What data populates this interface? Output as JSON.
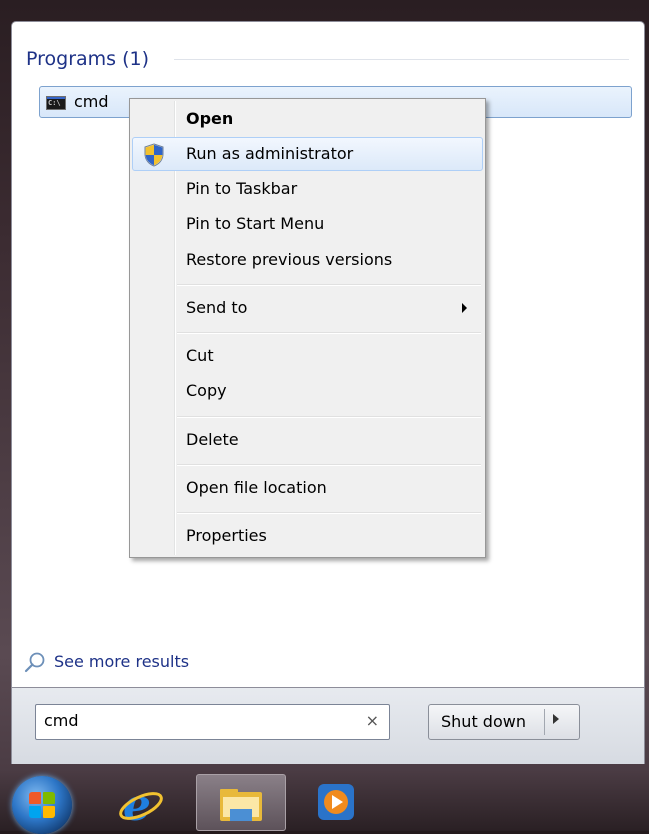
{
  "start_menu": {
    "programs_header": "Programs (1)",
    "result": {
      "label": "cmd"
    },
    "see_more": "See more results",
    "search": {
      "value": "cmd",
      "clear": "×"
    },
    "shutdown_label": "Shut down"
  },
  "context_menu": {
    "items": [
      {
        "label": "Open"
      },
      {
        "label": "Run as administrator"
      },
      {
        "label": "Pin to Taskbar"
      },
      {
        "label": "Pin to Start Menu"
      },
      {
        "label": "Restore previous versions"
      },
      {
        "label": "Send to"
      },
      {
        "label": "Cut"
      },
      {
        "label": "Copy"
      },
      {
        "label": "Delete"
      },
      {
        "label": "Open file location"
      },
      {
        "label": "Properties"
      }
    ]
  },
  "taskbar": {
    "icons": [
      "start-orb-icon",
      "internet-explorer-icon",
      "windows-explorer-icon",
      "windows-media-player-icon"
    ]
  },
  "colors": {
    "header_text": "#1e3287",
    "selection_border": "#7da2ce",
    "menu_background": "#f0f0f0"
  }
}
